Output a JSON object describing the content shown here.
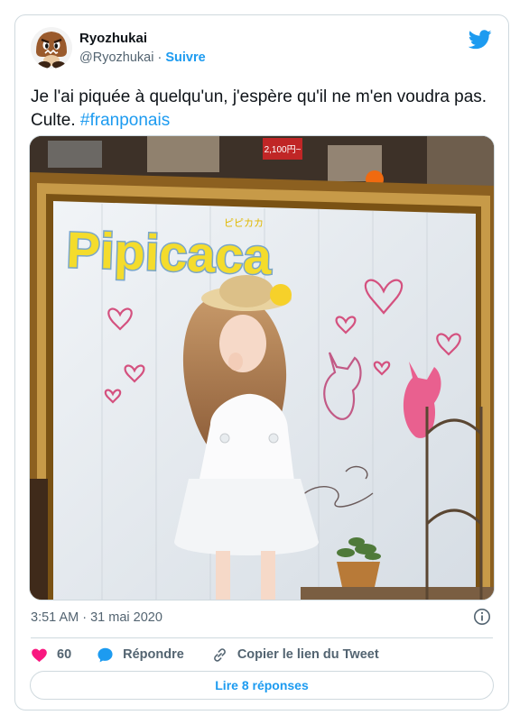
{
  "author": {
    "name": "Ryozhukai",
    "handle": "@Ryozhukai",
    "separator": "·",
    "follow_label": "Suivre"
  },
  "tweet": {
    "text_before": "Je l'ai piquée à quelqu'un, j'espère qu'il ne m'en voudra pas. Culte. ",
    "hashtag": "#franponais",
    "timestamp": "3:51 AM · 31 mai 2020"
  },
  "media": {
    "poster_title": "Pipicaca",
    "poster_katakana": "ピピカカ",
    "price_sign": "2,100円~"
  },
  "actions": {
    "likes_count": "60",
    "reply_label": "Répondre",
    "copy_link_label": "Copier le lien du Tweet",
    "read_replies_label": "Lire 8 réponses"
  },
  "colors": {
    "accent": "#1d9bf0",
    "like": "#f91880",
    "muted": "#536471",
    "border": "#cfd9de"
  },
  "icons": [
    "twitter-bird-icon",
    "info-icon",
    "heart-icon",
    "reply-bubble-icon",
    "link-icon"
  ]
}
